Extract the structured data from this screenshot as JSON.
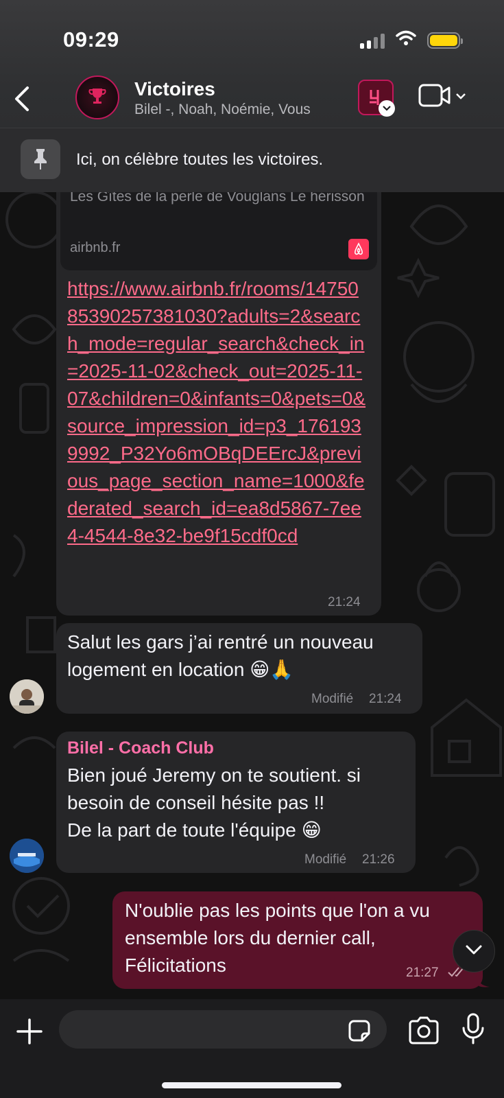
{
  "status_bar": {
    "time": "09:29"
  },
  "header": {
    "title": "Victoires",
    "members": "Bilel -, Noah, Noémie, Vous"
  },
  "pinned": {
    "text": "Ici, on célèbre toutes les victoires."
  },
  "messages": {
    "link_preview": {
      "title": "Les Gîtes de la perle de Vouglans Le hérisson",
      "domain": "airbnb.fr",
      "url": "https://www.airbnb.fr/rooms/1475085390257381030?adults=2&search_mode=regular_search&check_in=2025-11-02&check_out=2025-11-07&children=0&infants=0&pets=0&source_impression_id=p3_1761939992_P32Yo6mOBqDEErcJ&previous_page_section_name=1000&federated_search_id=ea8d5867-7ee4-4544-8e32-be9f15cdf0cd",
      "time": "21:24"
    },
    "msg2": {
      "text_line1": "Salut les gars j’ai rentré un nouveau",
      "text_line2": "logement en location 😁🙏",
      "edited": "Modifié",
      "time": "21:24"
    },
    "msg3": {
      "sender": "Bilel - Coach Club",
      "line1": "Bien joué Jeremy  on te soutient. si",
      "line2": "besoin de conseil hésite pas  !!",
      "line3": "De la part de toute l'équipe 😁",
      "edited": "Modifié",
      "time": "21:26"
    },
    "msg4": {
      "line1": "N'oublie pas les points que l'on a vu",
      "line2": "ensemble lors du dernier call,",
      "line3": "Félicitations",
      "time": "21:27"
    }
  },
  "colors": {
    "accent_pink": "#ff6b8a",
    "outgoing_bubble": "#5a1229",
    "sender_name": "#ff6fa8",
    "battery": "#ffd60a"
  },
  "icons": [
    "back-chevron-icon",
    "trophy-icon",
    "video-call-icon",
    "pin-icon",
    "airbnb-icon",
    "plus-icon",
    "sticker-icon",
    "camera-icon",
    "mic-icon",
    "chevron-down-icon",
    "double-check-icon"
  ]
}
